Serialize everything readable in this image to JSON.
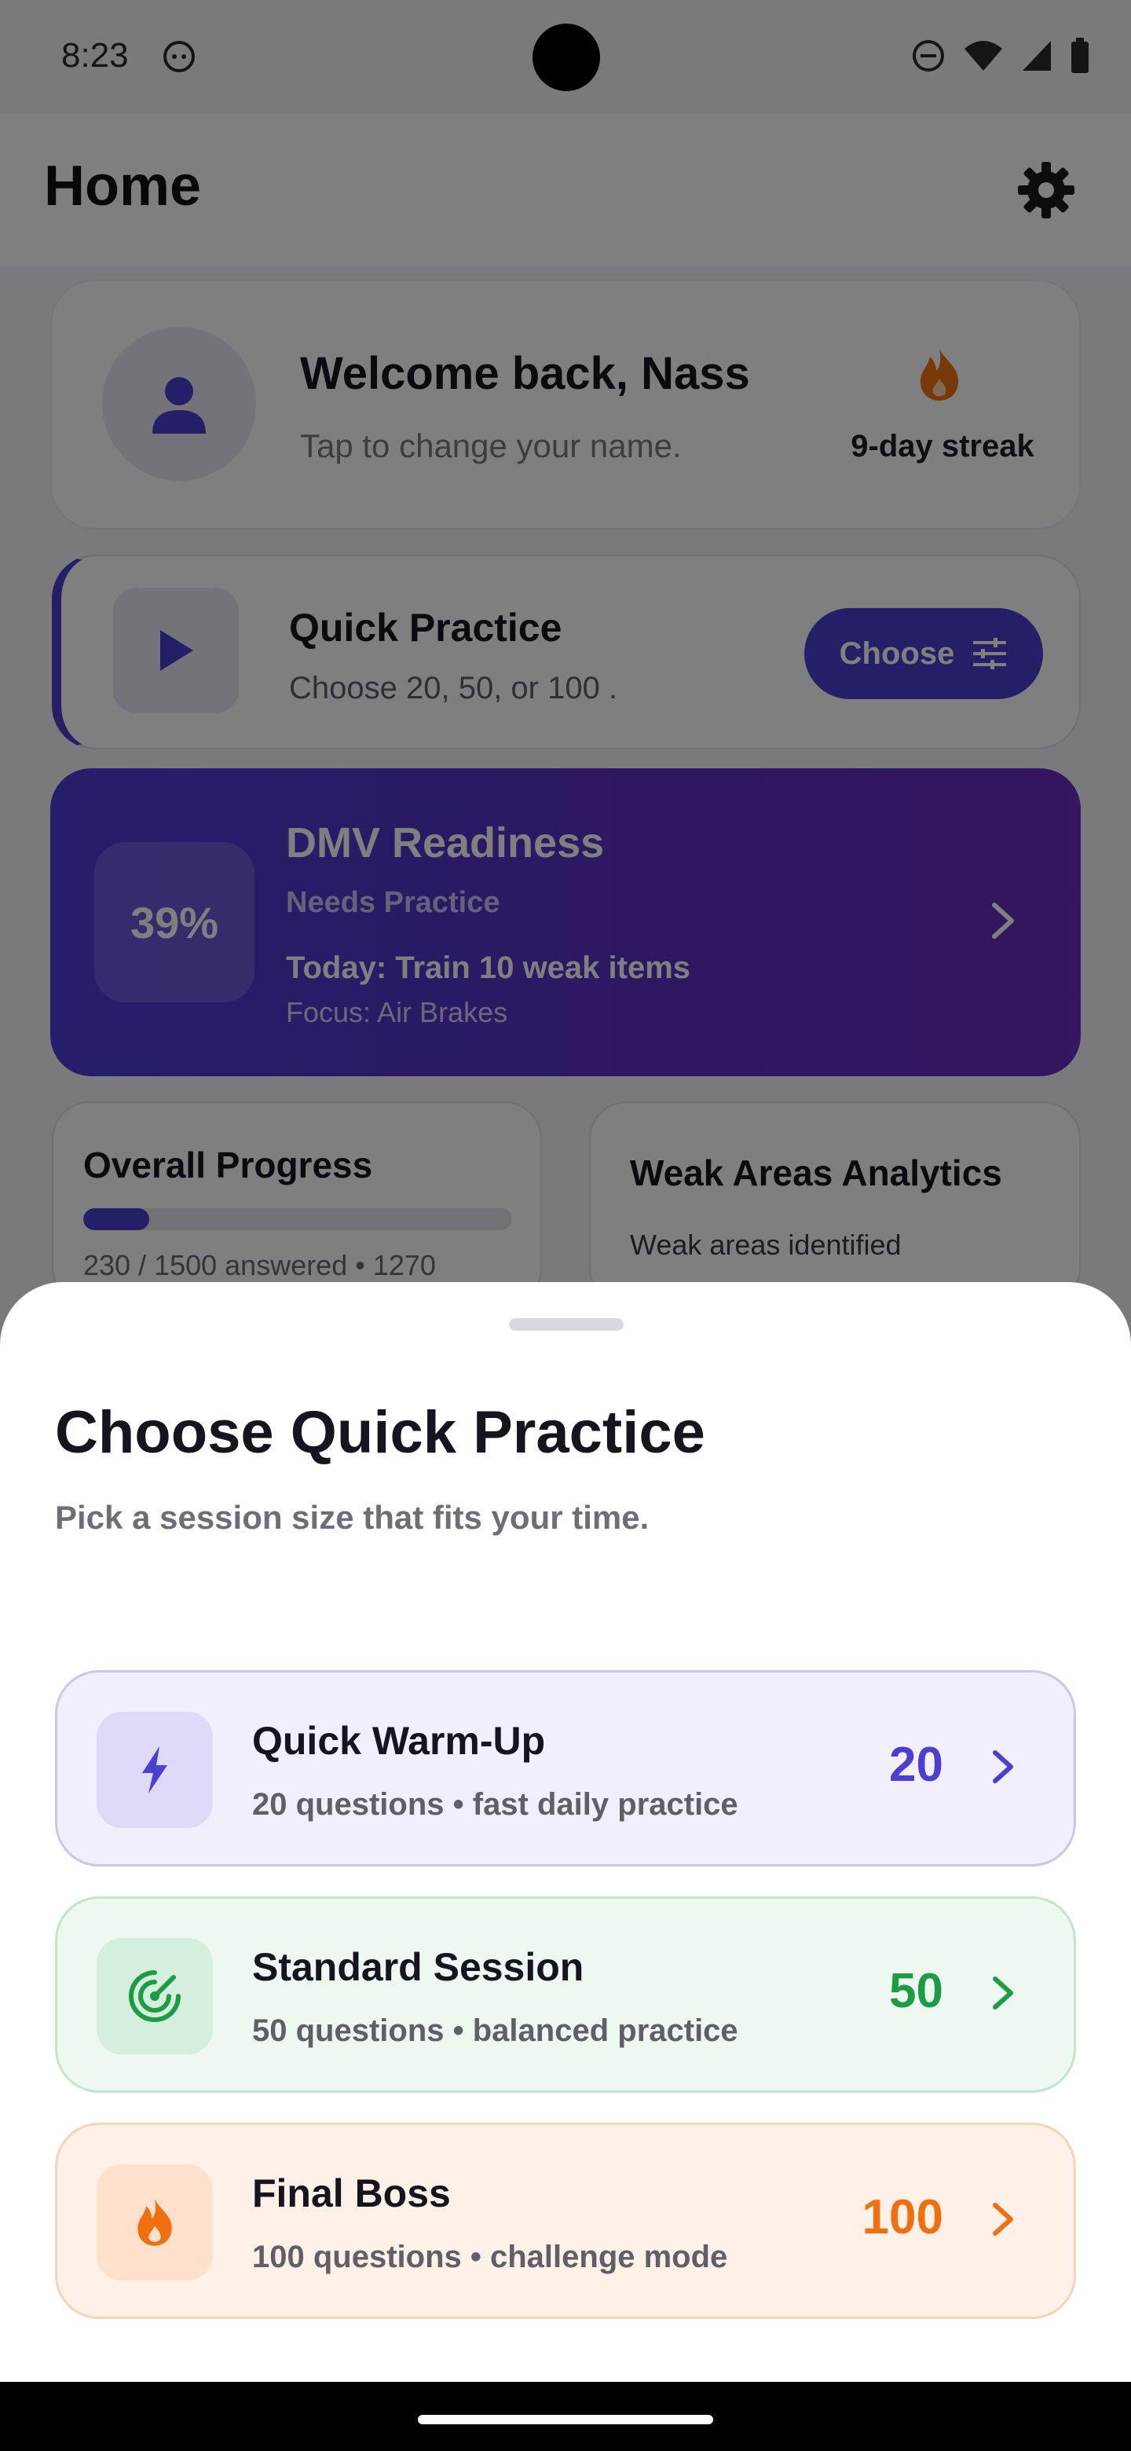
{
  "status": {
    "time": "8:23"
  },
  "appbar": {
    "title": "Home"
  },
  "welcome": {
    "title": "Welcome back, Nass",
    "subtitle": "Tap to change your name.",
    "streak": "9-day streak"
  },
  "quick_practice": {
    "title": "Quick Practice",
    "subtitle": "Choose 20, 50, or 100 .",
    "button": "Choose"
  },
  "readiness": {
    "percent": "39%",
    "title": "DMV Readiness",
    "status": "Needs Practice",
    "today": "Today: Train 10 weak items",
    "focus": "Focus: Air Brakes"
  },
  "overall": {
    "title": "Overall Progress",
    "progress_fraction": 0.153,
    "text": "230 / 1500 answered • 1270"
  },
  "weak_areas": {
    "title": "Weak Areas Analytics",
    "text": "Weak areas identified"
  },
  "sheet": {
    "title": "Choose Quick Practice",
    "subtitle": "Pick a session size that fits your time.",
    "options": [
      {
        "title": "Quick Warm-Up",
        "subtitle": "20 questions • fast daily practice",
        "count": "20",
        "icon": "bolt-icon",
        "accent": "#4a3fcf",
        "bg": "#f0effb",
        "border": "#cbc6f0",
        "icon_bg": "#dddaf7"
      },
      {
        "title": "Standard Session",
        "subtitle": "50 questions • balanced practice",
        "count": "50",
        "icon": "target-icon",
        "accent": "#1e9b45",
        "bg": "#edf8f0",
        "border": "#bfe6cb",
        "icon_bg": "#d4f0dc"
      },
      {
        "title": "Final Boss",
        "subtitle": "100 questions • challenge mode",
        "count": "100",
        "icon": "flame-icon",
        "accent": "#f07010",
        "bg": "#fff1e8",
        "border": "#f8d3b8",
        "icon_bg": "#ffe0cc"
      }
    ]
  }
}
